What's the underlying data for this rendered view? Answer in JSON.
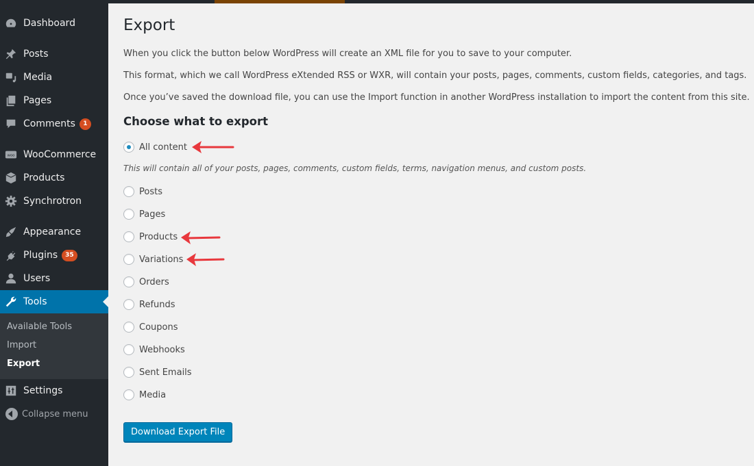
{
  "sidebar": {
    "items": [
      {
        "label": "Dashboard",
        "icon": "dashboard-icon"
      },
      {
        "label": "Posts",
        "icon": "pin-icon"
      },
      {
        "label": "Media",
        "icon": "media-icon"
      },
      {
        "label": "Pages",
        "icon": "pages-icon"
      },
      {
        "label": "Comments",
        "icon": "comment-icon",
        "badge": "1"
      },
      {
        "label": "WooCommerce",
        "icon": "woo-icon"
      },
      {
        "label": "Products",
        "icon": "box-icon"
      },
      {
        "label": "Synchrotron",
        "icon": "gear-icon"
      },
      {
        "label": "Appearance",
        "icon": "brush-icon"
      },
      {
        "label": "Plugins",
        "icon": "plug-icon",
        "badge": "35"
      },
      {
        "label": "Users",
        "icon": "user-icon"
      },
      {
        "label": "Tools",
        "icon": "wrench-icon",
        "active": true
      },
      {
        "label": "Settings",
        "icon": "settings-icon"
      }
    ],
    "submenu": [
      "Available Tools",
      "Import",
      "Export"
    ],
    "submenu_current": "Export",
    "collapse_label": "Collapse menu"
  },
  "main": {
    "title": "Export",
    "paragraphs": [
      "When you click the button below WordPress will create an XML file for you to save to your computer.",
      "This format, which we call WordPress eXtended RSS or WXR, will contain your posts, pages, comments, custom fields, categories, and tags.",
      "Once you’ve saved the download file, you can use the Import function in another WordPress installation to import the content from this site."
    ],
    "section_title": "Choose what to export",
    "options": [
      "All content",
      "Posts",
      "Pages",
      "Products",
      "Variations",
      "Orders",
      "Refunds",
      "Coupons",
      "Webhooks",
      "Sent Emails",
      "Media"
    ],
    "selected_option": "All content",
    "all_content_description": "This will contain all of your posts, pages, comments, custom fields, terms, navigation menus, and custom posts.",
    "download_button": "Download Export File",
    "annotated_options": [
      "All content",
      "Products",
      "Variations"
    ]
  },
  "colors": {
    "accent": "#0073aa",
    "badge": "#d54e21",
    "arrow": "#e8383d",
    "top_highlight": "#7a4404"
  }
}
